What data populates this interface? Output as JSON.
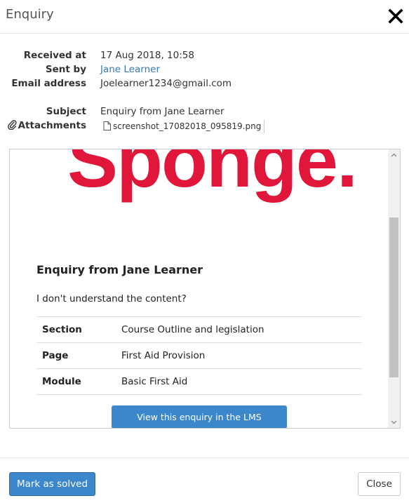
{
  "dialog": {
    "title": "Enquiry",
    "close_icon": "close-icon"
  },
  "meta": {
    "received_label": "Received at",
    "received_value": "17 Aug 2018, 10:58",
    "sent_by_label": "Sent by",
    "sent_by_value": "Jane Learner",
    "email_label": "Email address",
    "email_value": "Joelearner1234@gmail.com",
    "subject_label": "Subject",
    "subject_value": "Enquiry from Jane Learner",
    "attachments_label": "Attachments",
    "attachment_icon": "paperclip-icon",
    "attachment_file": "screenshot_17082018_095819.png",
    "attachment_file_icon": "file-icon"
  },
  "email": {
    "logo_text": "Sponge.",
    "heading": "Enquiry from Jane Learner",
    "body": "I don't understand the content?",
    "rows": [
      {
        "key": "Section",
        "value": "Course Outline and legislation"
      },
      {
        "key": "Page",
        "value": "First Aid Provision"
      },
      {
        "key": "Module",
        "value": "Basic First Aid"
      }
    ],
    "lms_button": "View this enquiry in the LMS"
  },
  "footer": {
    "mark_solved": "Mark as solved",
    "close": "Close"
  },
  "colors": {
    "brand_red": "#e0173a",
    "primary_blue": "#3c87cc",
    "link_blue": "#337ab7"
  }
}
